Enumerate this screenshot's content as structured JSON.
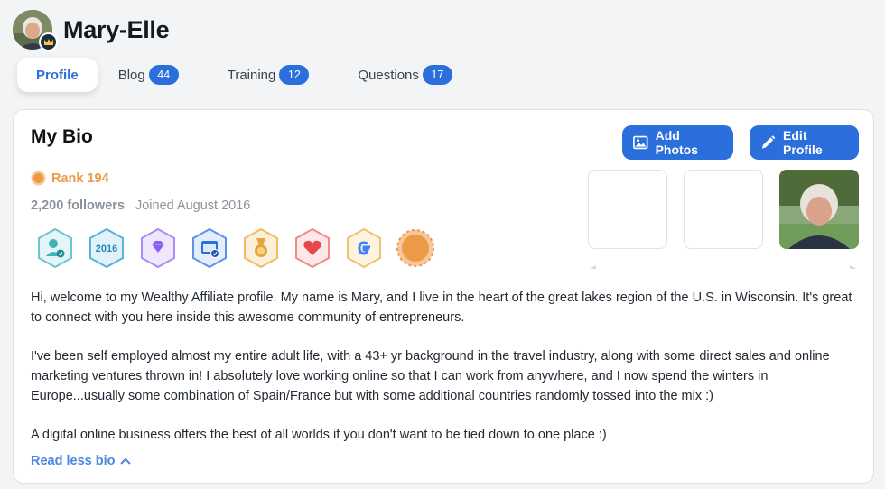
{
  "header": {
    "username": "Mary-Elle",
    "avatar_icon": "user-photo-avatar",
    "status_icon": "crown-icon"
  },
  "tabs": [
    {
      "label": "Profile",
      "count": null,
      "active": true
    },
    {
      "label": "Blog",
      "count": "44"
    },
    {
      "label": "Training",
      "count": "12"
    },
    {
      "label": "Questions",
      "count": "17"
    }
  ],
  "bio": {
    "title": "My Bio",
    "add_photos_label": "Add Photos",
    "edit_profile_label": "Edit Profile",
    "rank_label": "Rank 194",
    "followers": "2,200 followers",
    "joined": "Joined August 2016",
    "achievement_badges": [
      {
        "icon": "certified-user-badge",
        "color": "#3fb3b8"
      },
      {
        "icon": "year-2016-badge",
        "text": "2016",
        "color": "#2aa1c8"
      },
      {
        "icon": "diamond-badge",
        "color": "#8b5cf6"
      },
      {
        "icon": "website-verified-badge",
        "color": "#2b6fdc"
      },
      {
        "icon": "medal-badge",
        "color": "#e8a33a"
      },
      {
        "icon": "heart-badge",
        "color": "#e5484d"
      },
      {
        "icon": "google-badge",
        "color": "#3b82f6"
      },
      {
        "icon": "rank-sun-badge",
        "color": "#ec9a45"
      }
    ],
    "paragraphs": [
      "Hi, welcome to my Wealthy Affiliate profile. My name is Mary, and I live in the heart of the great lakes region of the U.S. in Wisconsin. It's great to connect with you here inside this awesome community of entrepreneurs.",
      "I've been self employed almost my entire adult life, with a 43+ yr background in the travel industry, along with some direct sales and online marketing ventures thrown in! I absolutely love working online so that I can work from anywhere, and I now spend the winters in Europe...usually some combination of Spain/France but with some additional countries randomly tossed into the mix :)",
      "A digital online business offers the best of all worlds if you don't want to be tied down to one place :)"
    ],
    "read_less_label": "Read less bio"
  },
  "colors": {
    "accent": "#2b6fdc",
    "rank": "#ec9a45",
    "muted": "#8a929c"
  }
}
